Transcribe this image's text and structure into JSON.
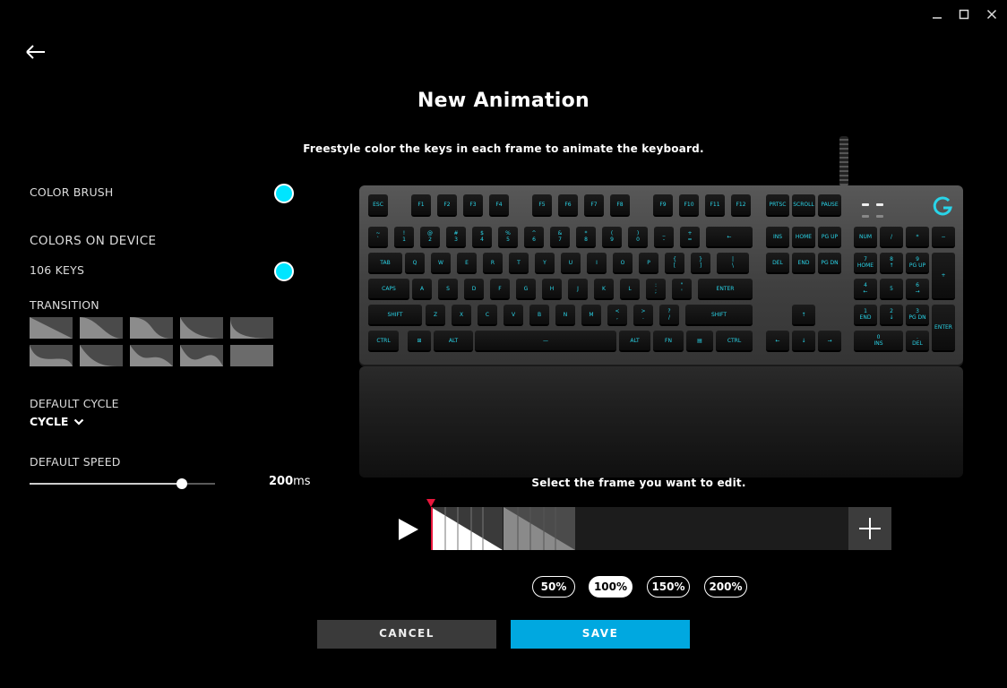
{
  "window": {
    "minimize_icon": "minimize-icon",
    "maximize_icon": "maximize-icon",
    "close_icon": "close-icon"
  },
  "header": {
    "title": "New Animation",
    "subtitle": "Freestyle color the keys in each frame to animate the keyboard."
  },
  "left_panel": {
    "color_brush_label": "COLOR BRUSH",
    "color_brush_color": "#00e5ff",
    "colors_on_device_label": "COLORS ON DEVICE",
    "keys_label": "106 KEYS",
    "keys_color": "#00e5ff",
    "transition_label": "TRANSITION",
    "transition_options": [
      "transition-1",
      "transition-2",
      "transition-3",
      "transition-4",
      "transition-5",
      "transition-6",
      "transition-7",
      "transition-8",
      "transition-9",
      "transition-10"
    ],
    "default_cycle_label": "DEFAULT CYCLE",
    "cycle_value": "CYCLE",
    "default_speed_label": "DEFAULT SPEED",
    "speed_value": "200",
    "speed_unit": "ms",
    "speed_slider_fraction": 0.82
  },
  "keyboard": {
    "accent_color": "#29d4e8",
    "rows": {
      "fn": [
        "ESC",
        "F1",
        "F2",
        "F3",
        "F4",
        "F5",
        "F6",
        "F7",
        "F8",
        "F9",
        "F10",
        "F11",
        "F12",
        "PRTSC",
        "SCROLL",
        "PAUSE"
      ],
      "num": [
        "~\n`",
        "!\n1",
        "@\n2",
        "#\n3",
        "$\n4",
        "%\n5",
        "^\n6",
        "&\n7",
        "*\n8",
        "(\n9",
        ")\n0",
        "_\n-",
        "+\n=",
        "←",
        "INS",
        "HOME",
        "PG UP",
        "NUM",
        "/",
        "*",
        "−"
      ],
      "top": [
        "TAB",
        "Q",
        "W",
        "E",
        "R",
        "T",
        "Y",
        "U",
        "I",
        "O",
        "P",
        "{\n[",
        "}\n]",
        "|\n\\",
        "DEL",
        "END",
        "PG DN",
        "7\nHOME",
        "8\n↑",
        "9\nPG UP",
        "+"
      ],
      "home": [
        "CAPS",
        "A",
        "S",
        "D",
        "F",
        "G",
        "H",
        "J",
        "K",
        "L",
        ":\n;",
        "\"\n'",
        "ENTER",
        "4\n←",
        "5",
        "6\n→"
      ],
      "shift": [
        "SHIFT",
        "Z",
        "X",
        "C",
        "V",
        "B",
        "N",
        "M",
        "<\n,",
        ">\n.",
        "?\n/",
        "SHIFT",
        "↑",
        "1\nEND",
        "2\n↓",
        "3\nPG DN",
        "ENTER"
      ],
      "bottom": [
        "CTRL",
        "⊞",
        "ALT",
        "—",
        "ALT",
        "FN",
        "▤",
        "CTRL",
        "←",
        "↓",
        "→",
        "0\nINS",
        ".\nDEL"
      ]
    }
  },
  "timeline": {
    "instruction": "Select the frame you want to edit.",
    "play_icon": "play-icon",
    "add_icon": "plus-icon",
    "marker_color": "#e8163c"
  },
  "zoom_options": [
    "50%",
    "100%",
    "150%",
    "200%"
  ],
  "zoom_selected": "100%",
  "actions": {
    "cancel": "CANCEL",
    "save": "SAVE",
    "save_color": "#00a8e0"
  }
}
